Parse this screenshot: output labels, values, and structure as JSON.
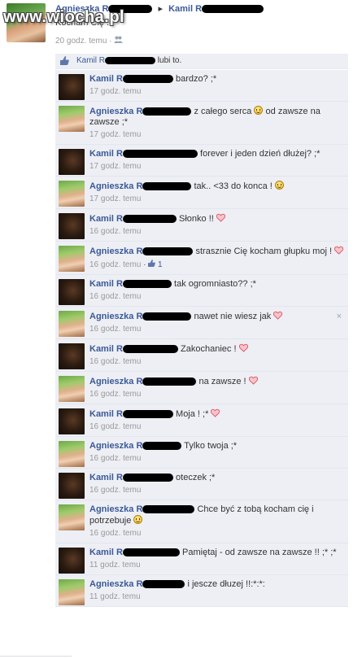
{
  "watermark": "www.wiocha.pl",
  "post": {
    "author": "Agnieszka R",
    "arrow": "▸",
    "recipient": "Kamil R",
    "text": "Kocham Cię :*",
    "time": "20 godz. temu",
    "audience_icon": "friends-icon"
  },
  "likes": {
    "name": "Kamil R",
    "suffix": "lubi to."
  },
  "comments": [
    {
      "author": "Kamil R",
      "avatar": "kamil",
      "text": "bardzo? ;*",
      "time": "17 godz. temu"
    },
    {
      "author": "Agnieszka R",
      "avatar": "ag",
      "text": "z całego serca",
      "emoji": "smile",
      "text2": "od zawsze na zawsze ;*",
      "time": "17 godz. temu"
    },
    {
      "author": "Kamil R",
      "avatar": "kamil",
      "text": "forever i jeden dzień dłużej? ;*",
      "time": "17 godz. temu"
    },
    {
      "author": "Agnieszka R",
      "avatar": "ag",
      "text": "tak.. <33 do konca !",
      "emoji": "smile",
      "time": "17 godz. temu"
    },
    {
      "author": "Kamil R",
      "avatar": "kamil",
      "text": "Słonko !!",
      "emoji": "heart",
      "time": "16 godz. temu"
    },
    {
      "author": "Agnieszka R",
      "avatar": "ag",
      "text": "strasznie Cię kocham głupku moj !",
      "emoji": "heart",
      "time": "16 godz. temu",
      "likes": "1"
    },
    {
      "author": "Kamil R",
      "avatar": "kamil",
      "text": "tak ogromniasto?? ;*",
      "time": "16 godz. temu"
    },
    {
      "author": "Agnieszka R",
      "avatar": "ag",
      "text": "nawet nie wiesz jak",
      "emoji": "heart",
      "time": "16 godz. temu",
      "close": "×"
    },
    {
      "author": "Kamil R",
      "avatar": "kamil",
      "text": "Zakochaniec !",
      "emoji": "heart",
      "time": "16 godz. temu"
    },
    {
      "author": "Agnieszka R",
      "avatar": "ag",
      "text": "na zawsze !",
      "emoji": "heart",
      "time": "16 godz. temu"
    },
    {
      "author": "Kamil R",
      "avatar": "kamil",
      "text": "Moja ! ;*",
      "emoji": "heart",
      "time": "16 godz. temu"
    },
    {
      "author": "Agnieszka R",
      "avatar": "ag",
      "text": "Tylko twoja ;*",
      "time": "16 godz. temu"
    },
    {
      "author": "Kamil R",
      "avatar": "kamil",
      "text": "oteczek ;*",
      "time": "16 godz. temu"
    },
    {
      "author": "Agnieszka R",
      "avatar": "ag",
      "text": "Chce być z tobą kocham cię i potrzebuje",
      "emoji": "smile",
      "time": "16 godz. temu"
    },
    {
      "author": "Kamil R",
      "avatar": "kamil",
      "text": "Pamiętaj - od zawsze na zawsze !! ;* ;*",
      "time": "11 godz. temu"
    },
    {
      "author": "Agnieszka R",
      "avatar": "ag",
      "text": "i jescze dłuzej !!:*:*:",
      "time": "11 godz. temu"
    }
  ],
  "colors": {
    "link": "#3b5998",
    "comment_bg": "#edeff4",
    "meta": "#999999",
    "heart": "#e0707a"
  }
}
